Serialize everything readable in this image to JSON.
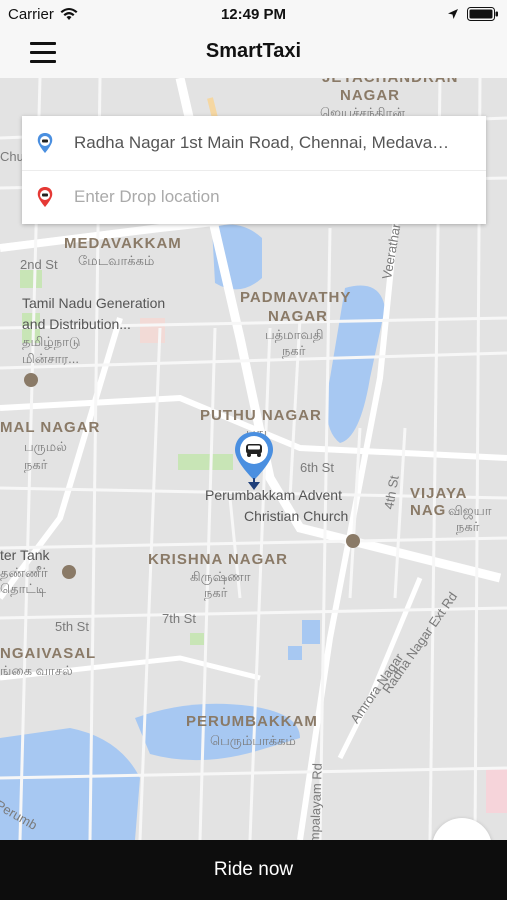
{
  "status": {
    "carrier": "Carrier",
    "time": "12:49 PM"
  },
  "header": {
    "title": "SmartTaxi"
  },
  "search": {
    "pickup_value": "Radha Nagar 1st Main Road, Chennai, Medava…",
    "drop_placeholder": "Enter Drop location"
  },
  "map_labels": {
    "jeyachandran": "JEYACHANDRAN",
    "nagar_top": "NAGAR",
    "nagar_top_ta": "ஜெயச்சந்திரன்",
    "chu": "Chu",
    "medavakkam": "MEDAVAKKAM",
    "medavakkam_ta": "மேடவாக்கம்",
    "second_st": "2nd St",
    "tamil_nadu": "Tamil Nadu Generation",
    "and_distribution": "and Distribution...",
    "tn_ta": "தமிழ்நாடு",
    "tn_ta2": "மின்சார...",
    "padmavathy": "PADMAVATHY",
    "padmavathy_nagar": "NAGAR",
    "padmavathy_ta": "பத்மாவதி",
    "padmavathy_ta2": "நகர்",
    "veerathamal": "Veerathamal",
    "mal_nagar": "MAL NAGAR",
    "mal_ta": "பருமல்",
    "mal_ta2": "நகர்",
    "puthu_nagar": "PUTHU NAGAR",
    "puthu_ta": "புது",
    "sixth_st": "6th St",
    "fourth_st": "4th St",
    "vijaya": "VIJAYA NAG",
    "vijaya_ta": "விஜயா",
    "vijaya_ta2": "நகர்",
    "advent": "Perumbakkam Advent",
    "christian_church": "Christian Church",
    "water_tank": "ter Tank",
    "tank_ta": "தண்ணீர்",
    "tank_ta2": "தொட்டி",
    "krishna_nagar": "KRISHNA NAGAR",
    "krishna_ta": "கிருஷ்ணா",
    "krishna_ta2": "நகர்",
    "fifth_st": "5th St",
    "seventh_st": "7th St",
    "radha_ext": "Radha Nagar Ext Rd",
    "amrora": "Amrora Nagar",
    "ngaivasal": "NGAIVASAL",
    "ngaivasal_ta": "ங்கை வாசல்",
    "perumbakkam": "PERUMBAKKAM",
    "perumbakkam_ta": "பெரும்பாக்கம்",
    "mpalayam": "mpalayam Rd",
    "perumb": "Perumb"
  },
  "actions": {
    "ride_now": "Ride now"
  },
  "colors": {
    "accent": "#4a8fe0",
    "drop_pin": "#e53935",
    "water": "#a7c8f2",
    "bar": "#0d0d0d"
  },
  "icons": {
    "menu": "hamburger-icon",
    "pickup": "pickup-pin-icon",
    "drop": "drop-pin-icon",
    "car": "taxi-marker-icon"
  }
}
